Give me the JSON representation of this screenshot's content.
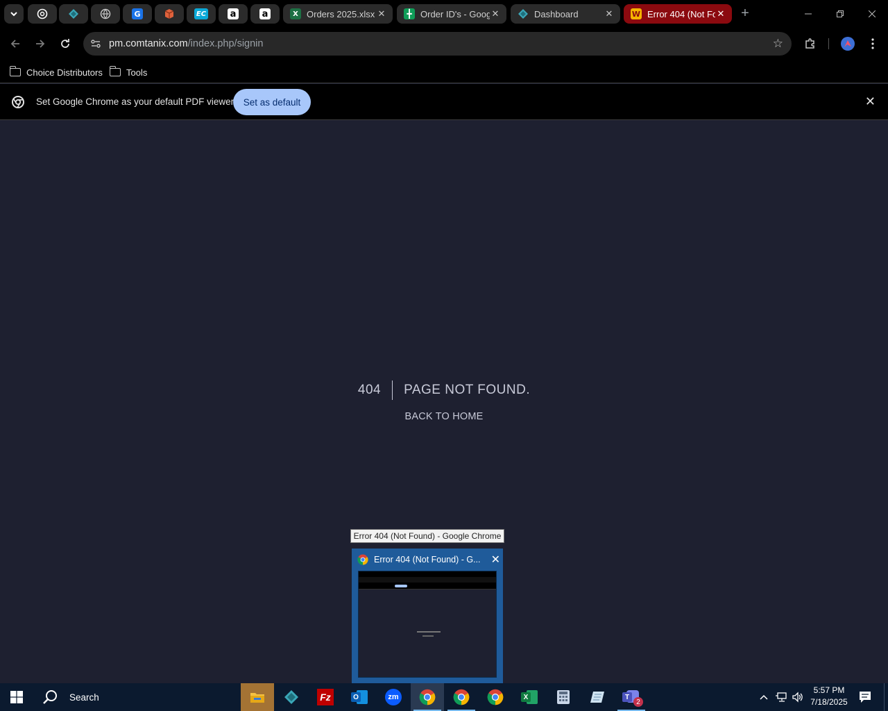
{
  "tabs": {
    "pinned": [
      {
        "icon": "openai-icon",
        "color": "#ffffff"
      },
      {
        "icon": "diamond-teal-icon",
        "color": "#3aa7b8"
      },
      {
        "icon": "globe-icon",
        "color": "#c7c7c7"
      },
      {
        "icon": "g-blue-icon",
        "color": "#1a73e8"
      },
      {
        "icon": "box-icon",
        "color": "#e0623c"
      },
      {
        "icon": "ec-icon",
        "color": "#0aa9d8"
      },
      {
        "icon": "amazon-icon",
        "color": "#ffffff"
      },
      {
        "icon": "amazon-icon",
        "color": "#ffffff"
      }
    ],
    "items": [
      {
        "title": "Orders 2025.xlsx",
        "icon": "excel-icon"
      },
      {
        "title": "Order ID's - Goog",
        "icon": "sheets-icon"
      },
      {
        "title": "Dashboard",
        "icon": "diamond-teal-icon"
      },
      {
        "title": "Error 404 (Not Fo",
        "icon": "w-yellow-icon"
      }
    ]
  },
  "toolbar": {
    "url_host": "pm.comtanix.com",
    "url_path": "/index.php/signin"
  },
  "bookmarks": [
    "Choice Distributors",
    "Tools"
  ],
  "infobar": {
    "message": "Set Google Chrome as your default PDF viewer",
    "button": "Set as default"
  },
  "page": {
    "code": "404",
    "message": "PAGE NOT FOUND.",
    "link": "BACK TO HOME"
  },
  "thumbnail": {
    "tooltip": "Error 404 (Not Found) - Google Chrome",
    "title": "Error 404 (Not Found) - G..."
  },
  "taskbar": {
    "search": "Search",
    "time": "5:57 PM",
    "date": "7/18/2025",
    "teams_badge": "2"
  }
}
